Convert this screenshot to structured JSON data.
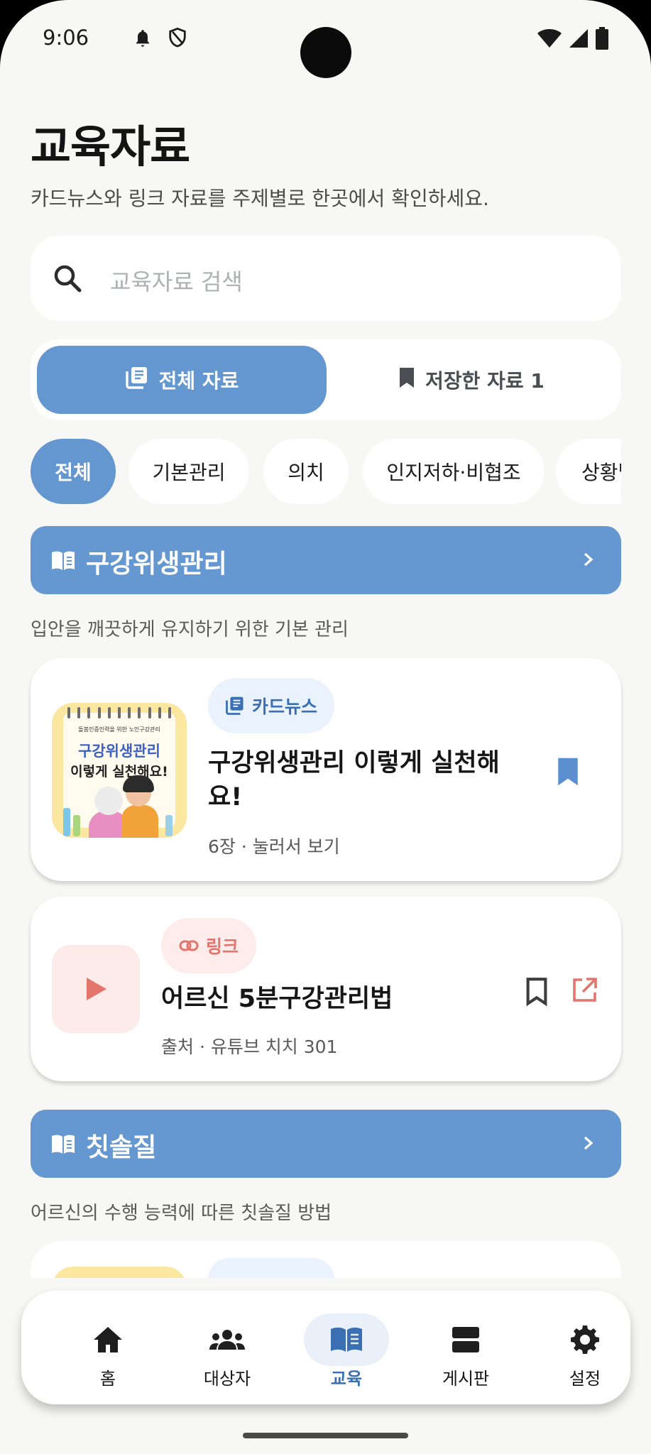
{
  "status": {
    "time": "9:06"
  },
  "header": {
    "title": "교육자료",
    "subtitle": "카드뉴스와 링크 자료를 주제별로 한곳에서 확인하세요."
  },
  "search": {
    "placeholder": "교육자료 검색"
  },
  "tabs": {
    "all": "전체 자료",
    "saved": "저장한 자료 1"
  },
  "chips": [
    "전체",
    "기본관리",
    "의치",
    "인지저하·비협조",
    "상황별"
  ],
  "sections": [
    {
      "title": "구강위생관리",
      "desc": "입안을 깨끗하게 유지하기 위한 기본 관리",
      "cards": [
        {
          "type": "카드뉴스",
          "title_line1": "구강위생관리 이렇게 실천해",
          "title_line2": "요!",
          "meta": "6장 · 눌러서 보기",
          "thumb_small": "돌봄인증인력을 위한 노인구강관리",
          "thumb_line1": "구강위생관리",
          "thumb_line2": "이렇게 실천해요!"
        },
        {
          "type": "링크",
          "title": "어르신 5분구강관리법",
          "meta": "출처 · 유튜브 치치 301"
        }
      ]
    },
    {
      "title": "칫솔질",
      "desc": "어르신의 수행 능력에 따른 칫솔질 방법"
    }
  ],
  "nav": [
    "홈",
    "대상자",
    "교육",
    "게시판",
    "설정"
  ],
  "colors": {
    "accent": "#6496d0",
    "link": "#e4756d"
  }
}
